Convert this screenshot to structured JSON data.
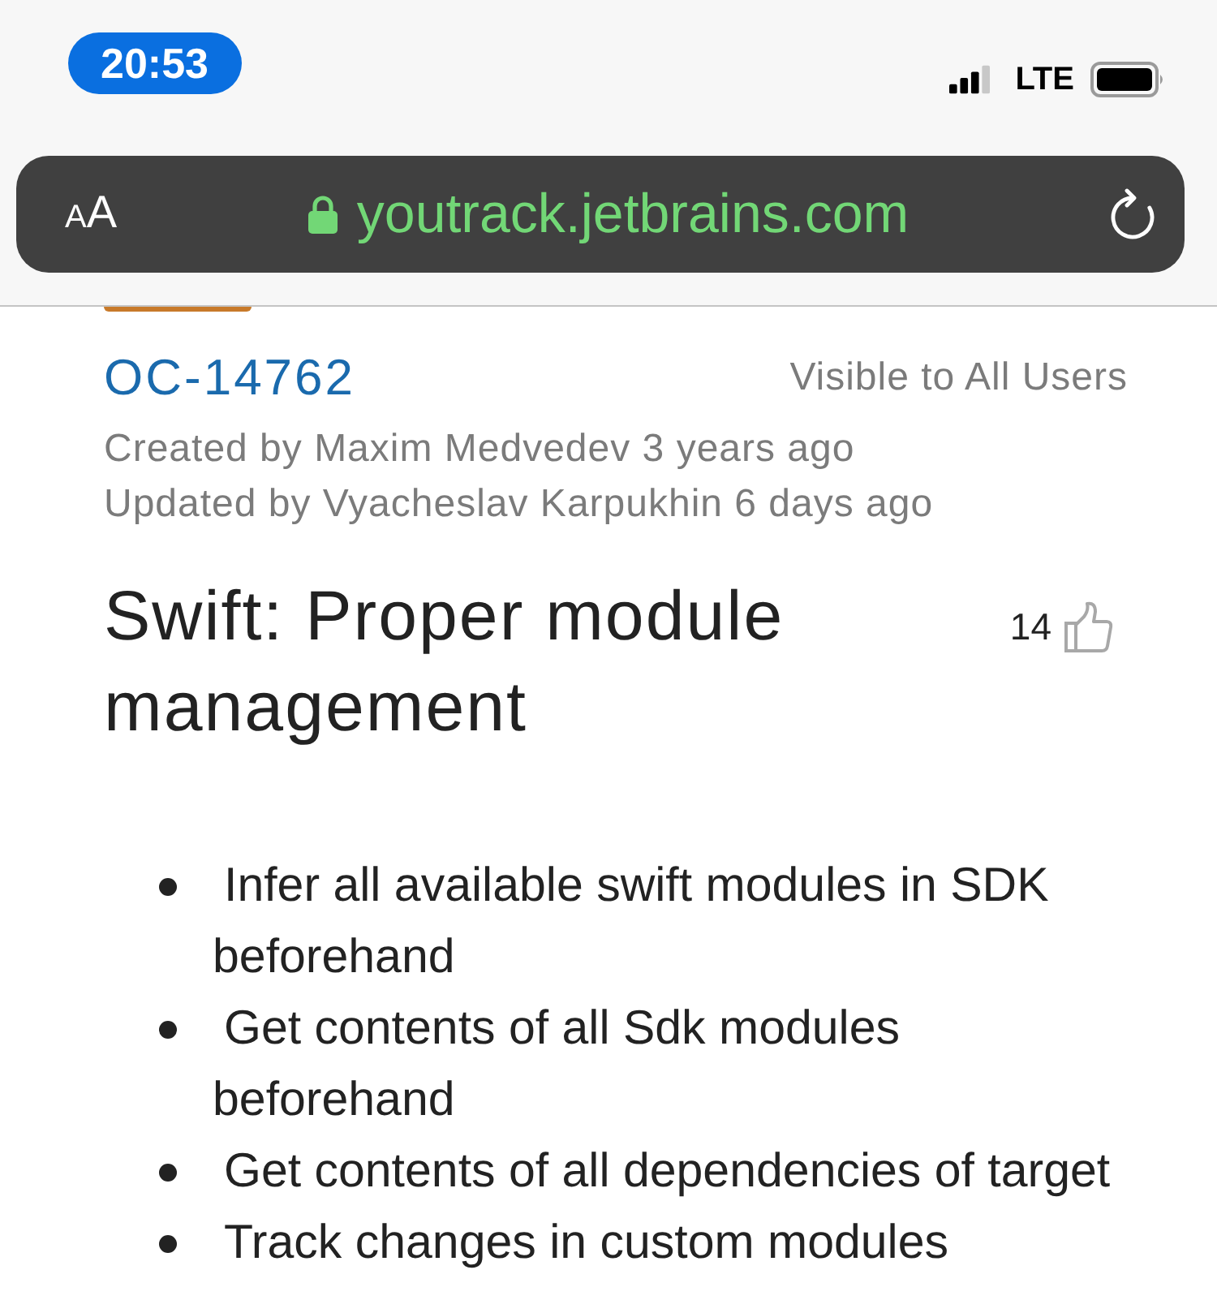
{
  "status_bar": {
    "time": "20:53",
    "network": "LTE"
  },
  "address_bar": {
    "text_size_label": "AA",
    "url": "youtrack.jetbrains.com"
  },
  "issue": {
    "id": "OC-14762",
    "visibility": "Visible to All Users",
    "created": "Created by Maxim Medvedev 3 years ago",
    "updated": "Updated by Vyacheslav Karpukhin 6 days ago",
    "title": "Swift: Proper module management",
    "votes": "14",
    "description_items": [
      "Infer all available swift modules in SDK beforehand",
      "Get contents of all Sdk modules beforehand",
      "Get contents of all dependencies of target",
      "Track changes in custom modules"
    ]
  }
}
